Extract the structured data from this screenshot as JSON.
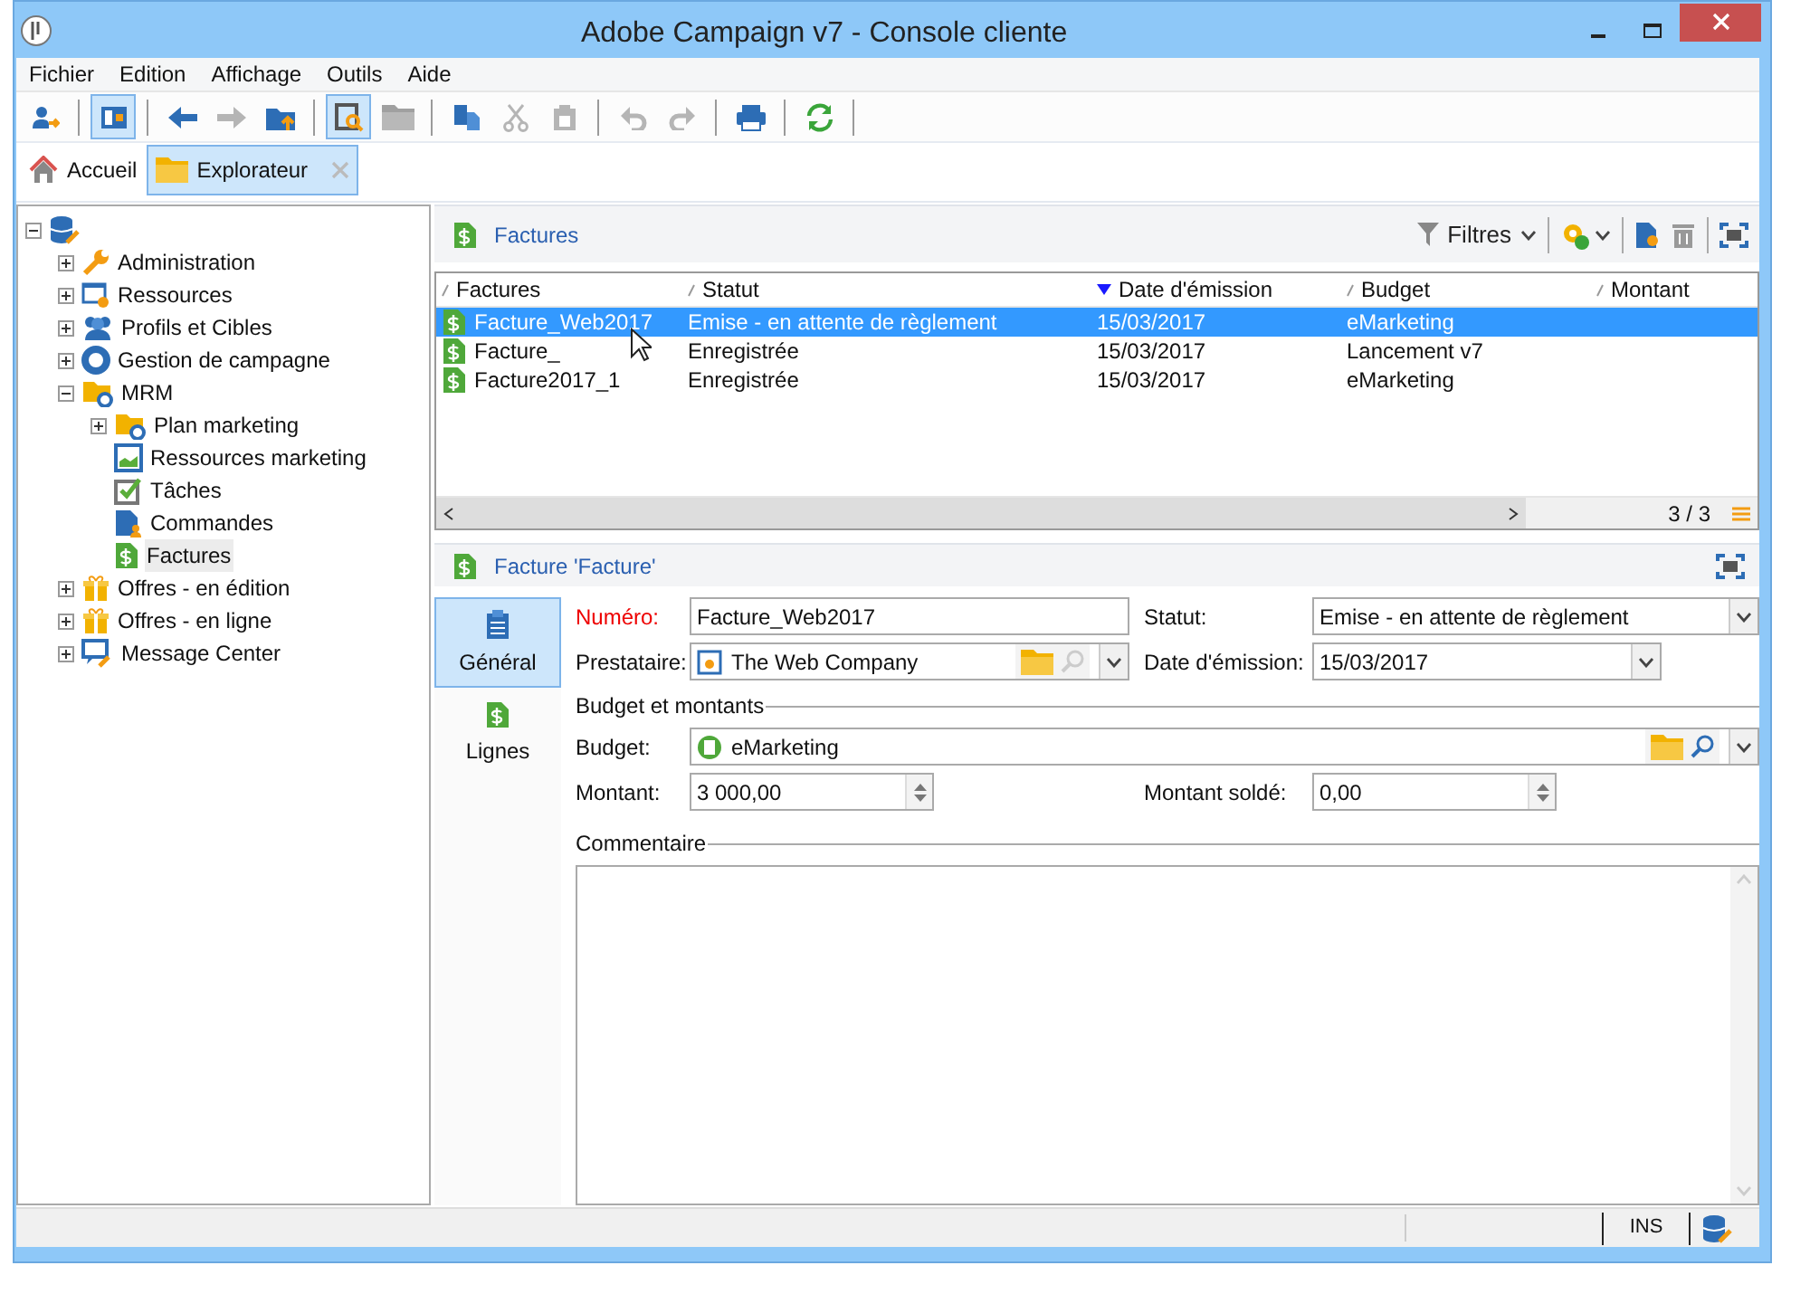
{
  "window": {
    "title": "Adobe Campaign v7 - Console cliente"
  },
  "menu": [
    "Fichier",
    "Edition",
    "Affichage",
    "Outils",
    "Aide"
  ],
  "toolbar": [
    {
      "kind": "button",
      "pressed": false,
      "disabled": false
    },
    {
      "kind": "separator"
    },
    {
      "kind": "button",
      "pressed": true,
      "disabled": false
    },
    {
      "kind": "separator"
    },
    {
      "kind": "button",
      "pressed": false,
      "disabled": false
    },
    {
      "kind": "button",
      "pressed": false,
      "disabled": true
    },
    {
      "kind": "button",
      "pressed": false,
      "disabled": false
    },
    {
      "kind": "separator"
    },
    {
      "kind": "button",
      "pressed": true,
      "disabled": false
    },
    {
      "kind": "button",
      "pressed": false,
      "disabled": true
    },
    {
      "kind": "separator"
    },
    {
      "kind": "button",
      "pressed": false,
      "disabled": false
    },
    {
      "kind": "button",
      "pressed": false,
      "disabled": true
    },
    {
      "kind": "button",
      "pressed": false,
      "disabled": true
    },
    {
      "kind": "separator"
    },
    {
      "kind": "button",
      "pressed": false,
      "disabled": true
    },
    {
      "kind": "button",
      "pressed": false,
      "disabled": true
    },
    {
      "kind": "separator"
    },
    {
      "kind": "button",
      "pressed": false,
      "disabled": false
    },
    {
      "kind": "separator"
    },
    {
      "kind": "button",
      "pressed": false,
      "disabled": false
    },
    {
      "kind": "separator"
    }
  ],
  "tabs": [
    {
      "label": "Accueil",
      "selected": false,
      "closable": false
    },
    {
      "label": "Explorateur",
      "selected": true,
      "closable": true
    }
  ],
  "tree": {
    "expanded": true,
    "children": [
      {
        "label": "Administration",
        "expanded": false,
        "selected": false
      },
      {
        "label": "Ressources",
        "expanded": false,
        "selected": false
      },
      {
        "label": "Profils et Cibles",
        "expanded": false,
        "selected": false
      },
      {
        "label": "Gestion de campagne",
        "expanded": false,
        "selected": false
      },
      {
        "label": "MRM",
        "expanded": true,
        "selected": false,
        "children": [
          {
            "label": "Plan marketing",
            "expanded": false,
            "selected": false
          },
          {
            "label": "Ressources marketing",
            "selected": false
          },
          {
            "label": "Tâches",
            "selected": false
          },
          {
            "label": "Commandes",
            "selected": false
          },
          {
            "label": "Factures",
            "selected": true
          }
        ]
      },
      {
        "label": "Offres - en édition",
        "expanded": false,
        "selected": false
      },
      {
        "label": "Offres - en ligne",
        "expanded": false,
        "selected": false
      },
      {
        "label": "Message Center",
        "expanded": false,
        "selected": false
      }
    ]
  },
  "list": {
    "title": "Factures",
    "filter_label": "Filtres",
    "columns": [
      {
        "label": "Factures",
        "sorted": false
      },
      {
        "label": "Statut",
        "sorted": false
      },
      {
        "label": "Date d'émission",
        "sorted": true
      },
      {
        "label": "Budget",
        "sorted": false
      },
      {
        "label": "Montant",
        "sorted": false
      }
    ],
    "rows": [
      {
        "cells": [
          "Facture_Web2017",
          "Emise - en attente de règlement",
          "15/03/2017",
          "eMarketing"
        ],
        "selected": true
      },
      {
        "cells": [
          "Facture_",
          "Enregistrée",
          "15/03/2017",
          "Lancement v7"
        ],
        "selected": false
      },
      {
        "cells": [
          "Facture2017_1",
          "Enregistrée",
          "15/03/2017",
          "eMarketing"
        ],
        "selected": false
      }
    ],
    "count": "3 / 3"
  },
  "detail": {
    "title": "Facture 'Facture'",
    "side_tabs": [
      {
        "label": "Général",
        "selected": true
      },
      {
        "label": "Lignes",
        "selected": false
      }
    ],
    "numero": {
      "label": "Numéro:",
      "required": true,
      "value": "Facture_Web2017"
    },
    "statut": {
      "label": "Statut:",
      "value": "Emise - en attente de règlement"
    },
    "prestataire": {
      "label": "Prestataire:",
      "value": "The Web Company"
    },
    "date": {
      "label": "Date d'émission:",
      "value": "15/03/2017"
    },
    "section_budget": "Budget et montants",
    "budget": {
      "label": "Budget:",
      "value": "eMarketing"
    },
    "montant": {
      "label": "Montant:",
      "value": "3 000,00"
    },
    "montant_solde": {
      "label": "Montant soldé:",
      "value": "0,00"
    },
    "section_comment": "Commentaire"
  },
  "status_bar": {
    "mode": "INS"
  }
}
